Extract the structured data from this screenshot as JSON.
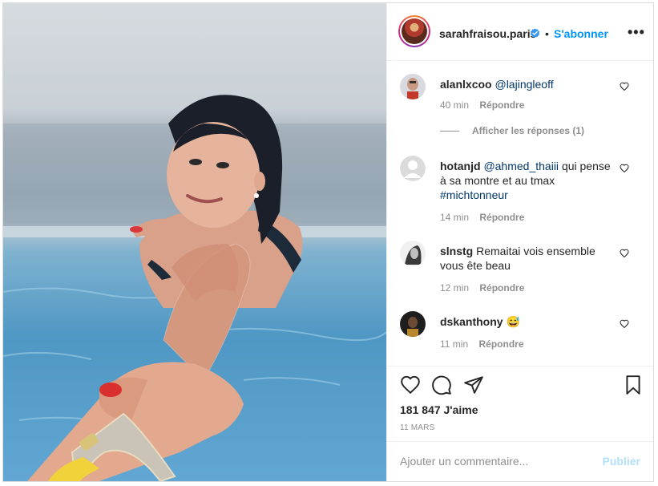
{
  "post": {
    "username": "sarahfraisou.paris",
    "verified_icon": "verified-badge-icon",
    "separator": "•",
    "follow_label": "S'abonner",
    "more_icon": "more-options-icon",
    "more_label": "•••"
  },
  "comments": [
    {
      "user": "alanlxcoo",
      "mention": "@lajingleoff",
      "text": "",
      "time": "40 min",
      "reply": "Répondre"
    },
    {
      "user": "hotanjd",
      "mention": "@ahmed_thaiii",
      "text": "qui pense à sa montre et au tmax",
      "tag": "#michtonneur",
      "time": "14 min",
      "reply": "Répondre"
    },
    {
      "user": "slnstg",
      "text": "Remaitai vois ensemble vous ête beau",
      "time": "12 min",
      "reply": "Répondre"
    },
    {
      "user": "dskanthony",
      "text": "😅",
      "time": "11 min",
      "reply": "Répondre"
    }
  ],
  "view_replies": "Afficher les réponses (1)",
  "actions": {
    "like_icon": "heart-icon",
    "comment_icon": "comment-icon",
    "share_icon": "share-icon",
    "save_icon": "bookmark-icon"
  },
  "likes": "181 847 J'aime",
  "date": "11 MARS",
  "add_comment": {
    "placeholder": "Ajouter un commentaire...",
    "publish": "Publier"
  },
  "colors": {
    "link": "#0095f6",
    "mention": "#00376b",
    "muted": "#8e8e8e",
    "publish_disabled": "#b2dffc"
  }
}
